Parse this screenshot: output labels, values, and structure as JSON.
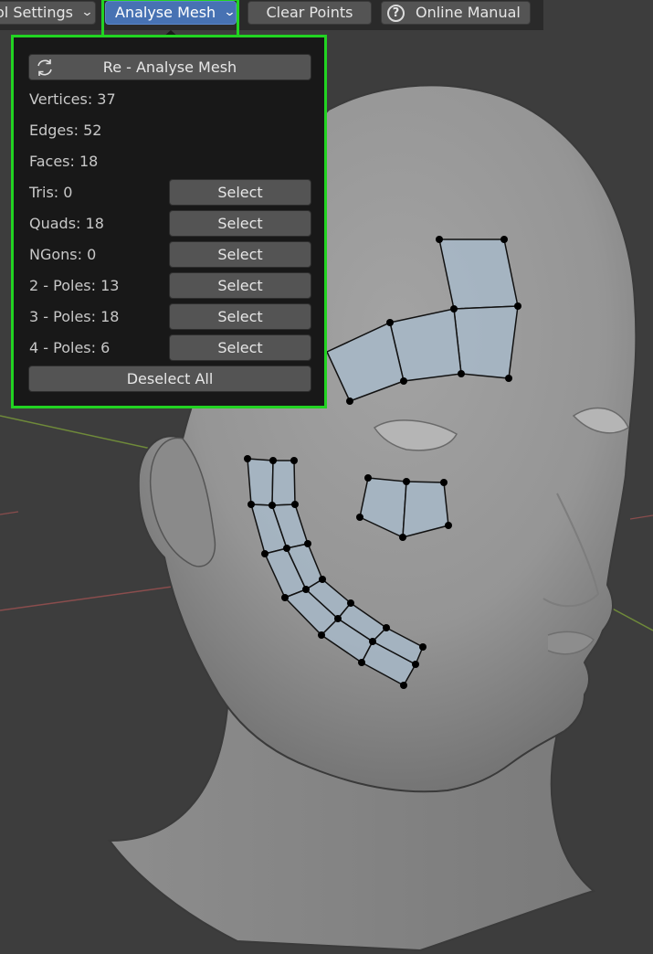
{
  "header": {
    "tool_settings_label": "ol Settings",
    "analyse_mesh_label": "Analyse Mesh",
    "clear_points_label": "Clear Points",
    "online_manual_label": "Online Manual",
    "help_glyph": "?"
  },
  "panel": {
    "reanalyse_label": "Re - Analyse Mesh",
    "stats": [
      {
        "label": "Vertices: 37"
      },
      {
        "label": "Edges: 52"
      },
      {
        "label": "Faces: 18"
      },
      {
        "label": "Tris: 0",
        "button": "Select"
      },
      {
        "label": "Quads: 18",
        "button": "Select"
      },
      {
        "label": "NGons: 0",
        "button": "Select"
      },
      {
        "label": "2 - Poles: 13",
        "button": "Select"
      },
      {
        "label": "3 - Poles: 18",
        "button": "Select"
      },
      {
        "label": "4 - Poles: 6",
        "button": "Select"
      }
    ],
    "deselect_all_label": "Deselect All"
  },
  "colors": {
    "highlight_frame": "#22d322",
    "active_button": "#4772b3",
    "mesh_fill": "#a7b8c8"
  },
  "icons": [
    "refresh-icon",
    "chevron-down-icon",
    "help-icon"
  ]
}
